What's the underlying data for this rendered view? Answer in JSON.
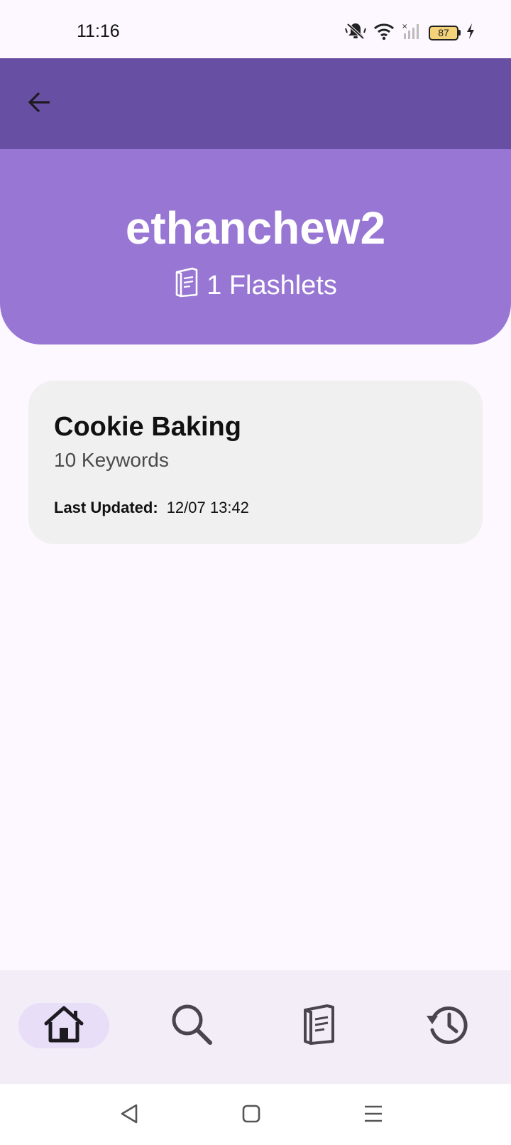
{
  "status_bar": {
    "time": "11:16",
    "battery": "87"
  },
  "profile": {
    "username": "ethanchew2",
    "flashlets_count": "1 Flashlets"
  },
  "flashlets": [
    {
      "title": "Cookie Baking",
      "keywords": "10 Keywords",
      "last_updated_label": "Last Updated:",
      "last_updated_value": "12/07 13:42"
    }
  ],
  "icons": {
    "back": "arrow-back-icon",
    "flashlet": "flashcard-icon",
    "nav_home": "home-icon",
    "nav_search": "search-icon",
    "nav_library": "flashcard-icon",
    "nav_history": "history-icon"
  },
  "colors": {
    "app_bar": "#6750a4",
    "header": "#9876d3",
    "card": "#f0f0f0",
    "nav_bg": "#f3edf7",
    "nav_active": "#e8def8",
    "background": "#fdf7ff"
  }
}
